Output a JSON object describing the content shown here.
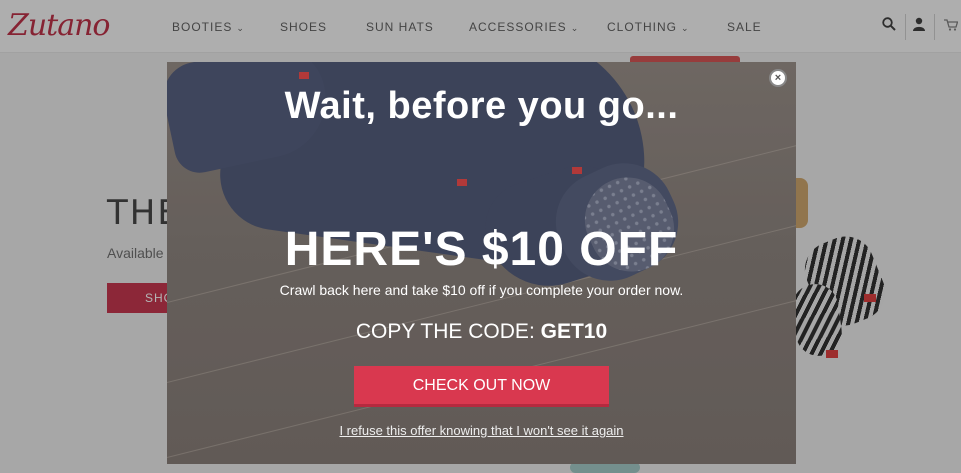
{
  "site": {
    "logo": "Zutano",
    "nav": [
      {
        "label": "BOOTIES",
        "dropdown": true
      },
      {
        "label": "SHOES",
        "dropdown": false
      },
      {
        "label": "SUN HATS",
        "dropdown": false
      },
      {
        "label": "ACCESSORIES",
        "dropdown": true
      },
      {
        "label": "CLOTHING",
        "dropdown": true
      },
      {
        "label": "SALE",
        "dropdown": false
      }
    ],
    "chevron": "⌄",
    "icons": {
      "search": "search-icon",
      "account": "user-icon",
      "cart": "cart-icon"
    },
    "hero": {
      "title": "THE",
      "subtitle": "Available",
      "button": "SHO"
    },
    "colors": {
      "brand": "#b9243c",
      "button": "#c22a44"
    }
  },
  "modal": {
    "close": "×",
    "headline": "Wait, before you go...",
    "offer": "HERE'S $10 OFF",
    "description": "Crawl back here and take $10 off if you complete your order now.",
    "code_label": "COPY THE CODE: ",
    "code": "GET10",
    "cta": "CHECK OUT NOW",
    "refuse": "I refuse this offer knowing that I won't see it again",
    "colors": {
      "cta": "#d9384f",
      "text": "#ffffff"
    }
  }
}
